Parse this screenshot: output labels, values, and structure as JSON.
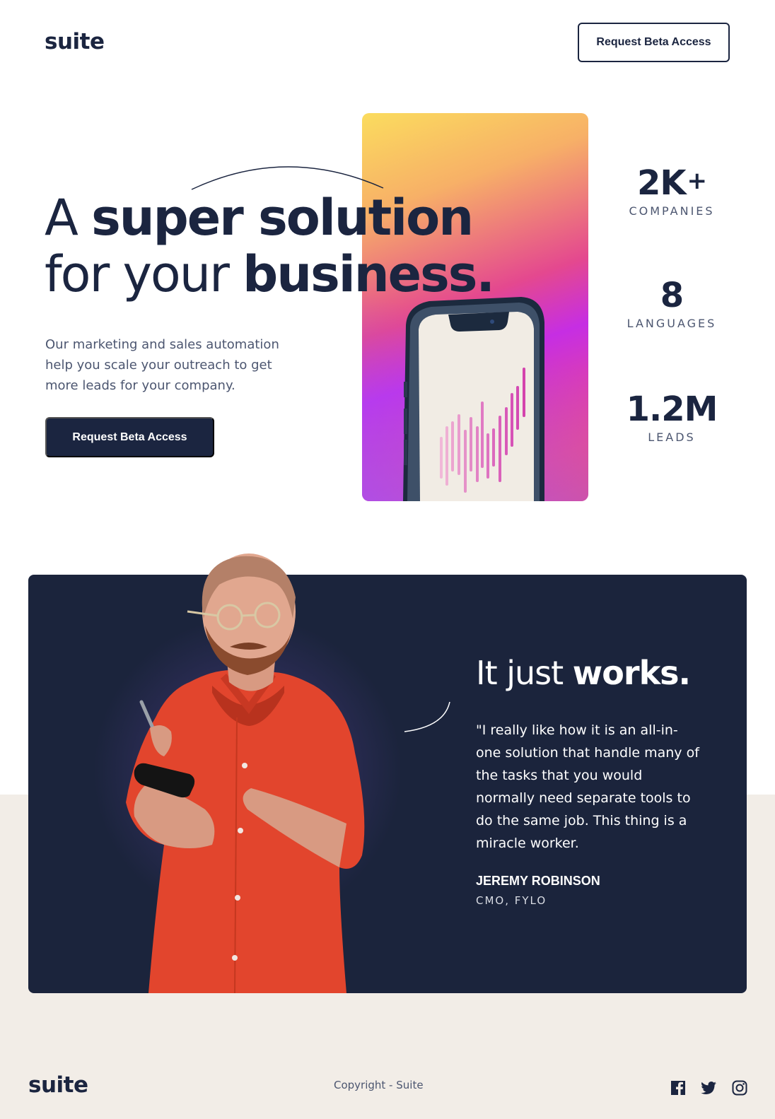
{
  "header": {
    "logo": "suite",
    "cta_label": "Request Beta Access"
  },
  "hero": {
    "headline_line1_thin": "A ",
    "headline_line1_bold": "super solution",
    "headline_line2_thin": "for your ",
    "headline_line2_bold": "business.",
    "description": "Our marketing and sales automation help you scale your outreach to get more leads for your company.",
    "cta_label": "Request Beta Access"
  },
  "stats": [
    {
      "value": "2K",
      "suffix": "+",
      "label": "COMPANIES"
    },
    {
      "value": "8",
      "suffix": "",
      "label": "LANGUAGES"
    },
    {
      "value": "1.2M",
      "suffix": "",
      "label": "LEADS"
    }
  ],
  "testimonial": {
    "title_thin": "It just ",
    "title_bold": "works.",
    "quote": "\"I really like how it is an all-in-one solution that handle many of the tasks that you would normally need separate tools to do the same job. This thing is a miracle worker.",
    "name": "JEREMY ROBINSON",
    "role": "CMO, FYLO"
  },
  "footer": {
    "logo": "suite",
    "copyright": "Copyright - Suite",
    "social_icons": [
      "facebook-icon",
      "twitter-icon",
      "instagram-icon"
    ]
  },
  "colors": {
    "navy": "#1b2540",
    "beige": "#f2ede7",
    "muted_text": "#4c5670"
  }
}
